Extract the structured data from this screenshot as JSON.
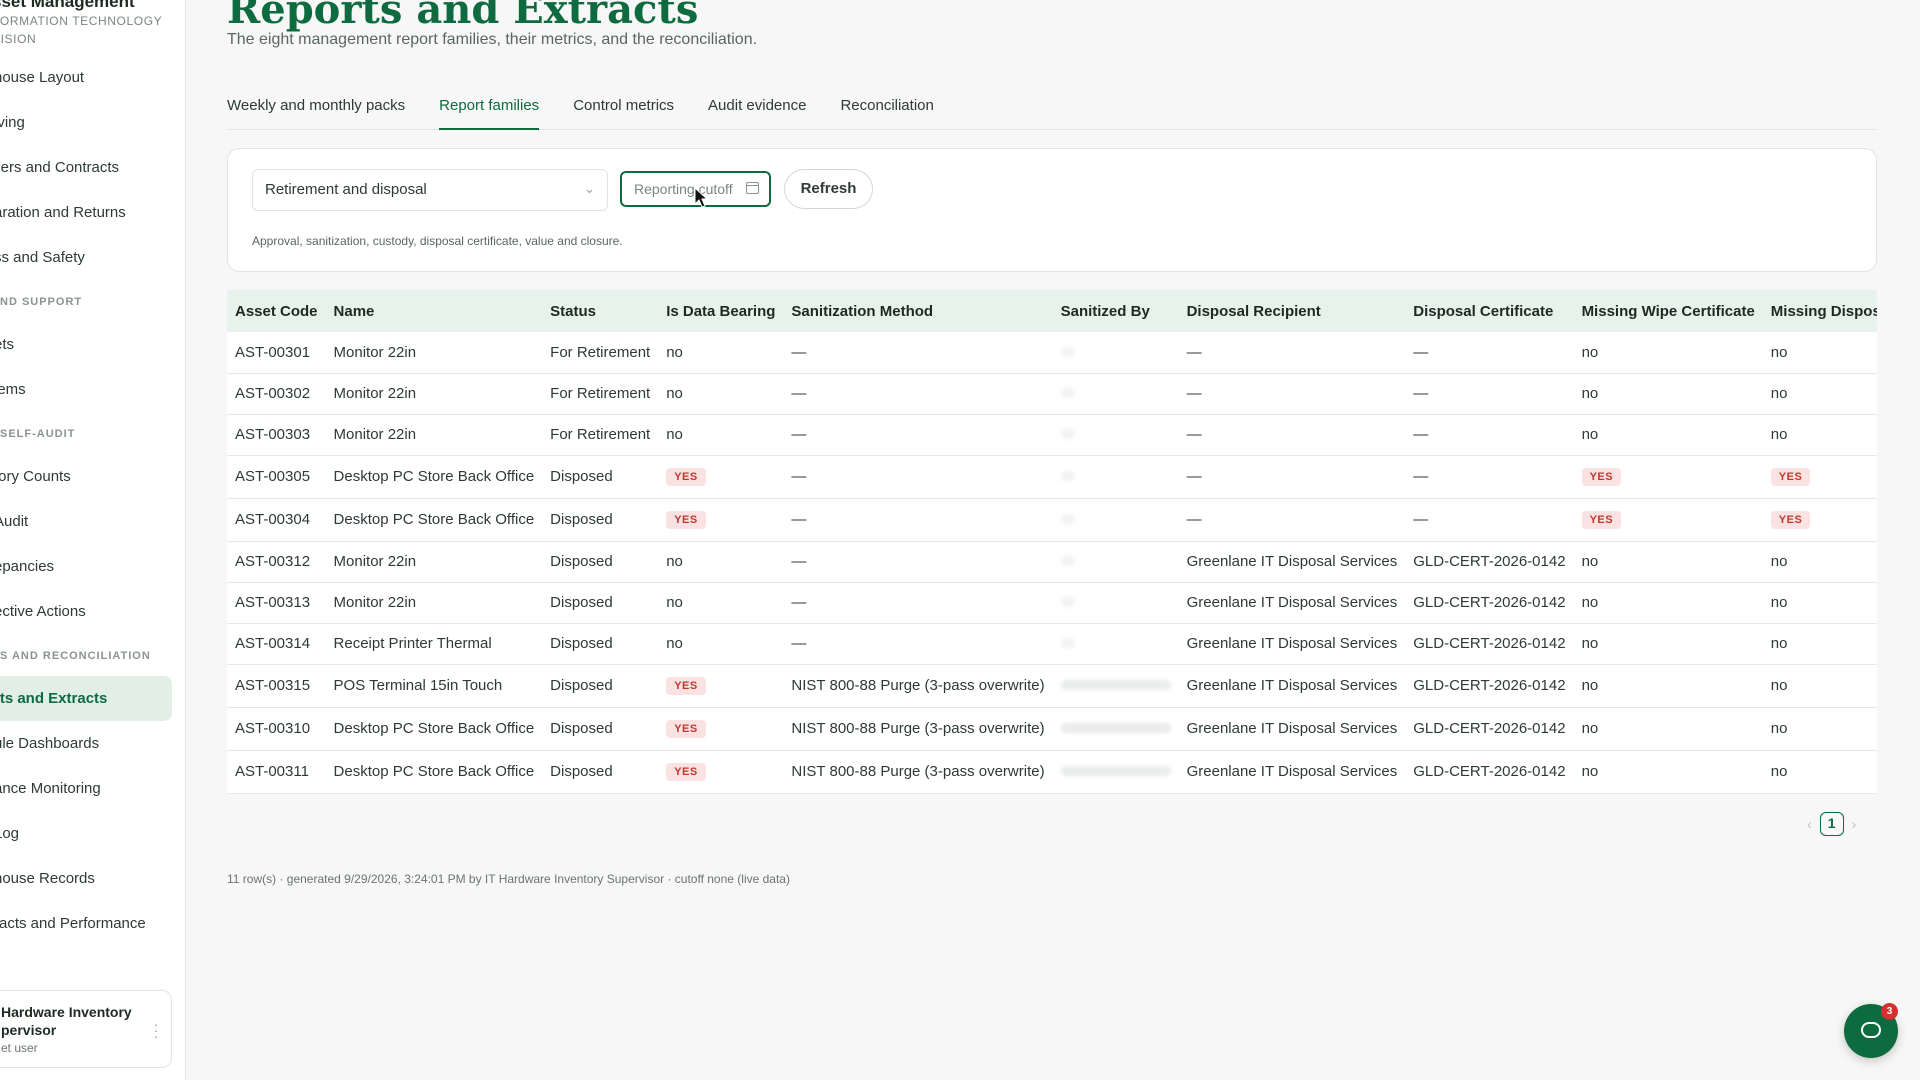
{
  "sidebar": {
    "brand_title": "sset Management",
    "brand_sub_1": "FORMATION TECHNOLOGY",
    "brand_sub_2": "VISION",
    "items": [
      {
        "type": "item",
        "label": "house Layout"
      },
      {
        "type": "item",
        "label": "iving"
      },
      {
        "type": "item",
        "label": "liers and Contracts"
      },
      {
        "type": "item",
        "label": "aration and Returns"
      },
      {
        "type": "item",
        "label": "ss and Safety"
      },
      {
        "type": "section",
        "label": "ND SUPPORT"
      },
      {
        "type": "item",
        "label": "ets"
      },
      {
        "type": "item",
        "label": "lems"
      },
      {
        "type": "section",
        "label": "SELF-AUDIT"
      },
      {
        "type": "item",
        "label": "tory Counts"
      },
      {
        "type": "item",
        "label": "Audit"
      },
      {
        "type": "item",
        "label": "epancies"
      },
      {
        "type": "item",
        "label": "ective Actions"
      },
      {
        "type": "section",
        "label": "S AND RECONCILIATION"
      },
      {
        "type": "item",
        "label": "rts and Extracts",
        "active": true
      },
      {
        "type": "item",
        "label": "ule Dashboards"
      },
      {
        "type": "item",
        "label": "ance Monitoring"
      },
      {
        "type": "item",
        "label": "Log"
      },
      {
        "type": "item",
        "label": "house Records"
      },
      {
        "type": "item",
        "label": "racts and Performance"
      }
    ],
    "user_name_1": "Hardware Inventory",
    "user_name_2": "pervisor",
    "user_role": "et user"
  },
  "header": {
    "title": "Reports and Extracts",
    "subtitle": "The eight management report families, their metrics, and the reconciliation."
  },
  "tabs": [
    {
      "label": "Weekly and monthly packs",
      "active": false
    },
    {
      "label": "Report families",
      "active": true
    },
    {
      "label": "Control metrics",
      "active": false
    },
    {
      "label": "Audit evidence",
      "active": false
    },
    {
      "label": "Reconciliation",
      "active": false
    }
  ],
  "filters": {
    "family_value": "Retirement and disposal",
    "cutoff_placeholder": "Reporting cutoff",
    "refresh_label": "Refresh",
    "description": "Approval, sanitization, custody, disposal certificate, value and closure."
  },
  "table": {
    "columns": [
      "Asset Code",
      "Name",
      "Status",
      "Is Data Bearing",
      "Sanitization Method",
      "Sanitized By",
      "Disposal Recipient",
      "Disposal Certificate",
      "Missing Wipe Certificate",
      "Missing Disposal Certifica"
    ],
    "rows": [
      [
        "AST-00301",
        "Monitor 22in",
        "For Retirement",
        "no",
        "—",
        "",
        "—",
        "—",
        "no",
        "no"
      ],
      [
        "AST-00302",
        "Monitor 22in",
        "For Retirement",
        "no",
        "—",
        "",
        "—",
        "—",
        "no",
        "no"
      ],
      [
        "AST-00303",
        "Monitor 22in",
        "For Retirement",
        "no",
        "—",
        "",
        "—",
        "—",
        "no",
        "no"
      ],
      [
        "AST-00305",
        "Desktop PC Store Back Office",
        "Disposed",
        "YES",
        "—",
        "",
        "—",
        "—",
        "YES",
        "YES"
      ],
      [
        "AST-00304",
        "Desktop PC Store Back Office",
        "Disposed",
        "YES",
        "—",
        "",
        "—",
        "—",
        "YES",
        "YES"
      ],
      [
        "AST-00312",
        "Monitor 22in",
        "Disposed",
        "no",
        "—",
        "",
        "Greenlane IT Disposal Services",
        "GLD-CERT-2026-0142",
        "no",
        "no"
      ],
      [
        "AST-00313",
        "Monitor 22in",
        "Disposed",
        "no",
        "—",
        "",
        "Greenlane IT Disposal Services",
        "GLD-CERT-2026-0142",
        "no",
        "no"
      ],
      [
        "AST-00314",
        "Receipt Printer Thermal",
        "Disposed",
        "no",
        "—",
        "",
        "Greenlane IT Disposal Services",
        "GLD-CERT-2026-0142",
        "no",
        "no"
      ],
      [
        "AST-00315",
        "POS Terminal 15in Touch",
        "Disposed",
        "YES",
        "NIST 800-88 Purge (3-pass overwrite)",
        "blurred",
        "Greenlane IT Disposal Services",
        "GLD-CERT-2026-0142",
        "no",
        "no"
      ],
      [
        "AST-00310",
        "Desktop PC Store Back Office",
        "Disposed",
        "YES",
        "NIST 800-88 Purge (3-pass overwrite)",
        "blurred",
        "Greenlane IT Disposal Services",
        "GLD-CERT-2026-0142",
        "no",
        "no"
      ],
      [
        "AST-00311",
        "Desktop PC Store Back Office",
        "Disposed",
        "YES",
        "NIST 800-88 Purge (3-pass overwrite)",
        "blurred",
        "Greenlane IT Disposal Services",
        "GLD-CERT-2026-0142",
        "no",
        "no"
      ]
    ]
  },
  "pagination": {
    "current_page": "1",
    "prev_icon": "chevron-left-icon",
    "next_icon": "chevron-right-icon"
  },
  "footer_note": "11 row(s) · generated 9/29/2026, 3:24:01 PM by IT Hardware Inventory Supervisor · cutoff none (live data)",
  "chat": {
    "badge": "3",
    "icon": "chat-bubble-icon"
  },
  "colors": {
    "accent": "#0e6b3f",
    "header_bg": "#e8f2ec",
    "yes_bg": "#fbe2e2",
    "yes_fg": "#c0392b"
  }
}
